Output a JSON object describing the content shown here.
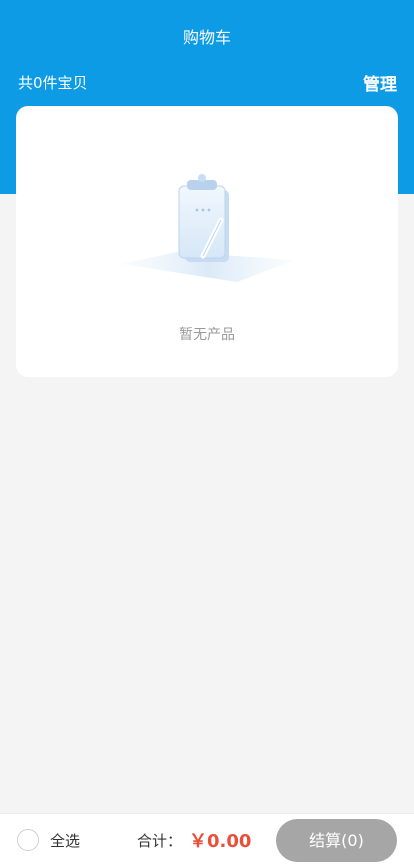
{
  "header": {
    "title": "购物车",
    "item_count_label": "共0件宝贝",
    "manage_label": "管理"
  },
  "empty_state": {
    "message": "暂无产品",
    "illustration_icon": "clipboard-pencil-icon"
  },
  "bottom_bar": {
    "select_all_label": "全选",
    "select_all_checked": false,
    "total_label": "合计：",
    "total_amount": "￥0.00",
    "checkout_label": "结算(0)"
  },
  "colors": {
    "header_bg": "#0d9be6",
    "price": "#e8503a",
    "checkout_disabled": "#a6a6a6"
  }
}
